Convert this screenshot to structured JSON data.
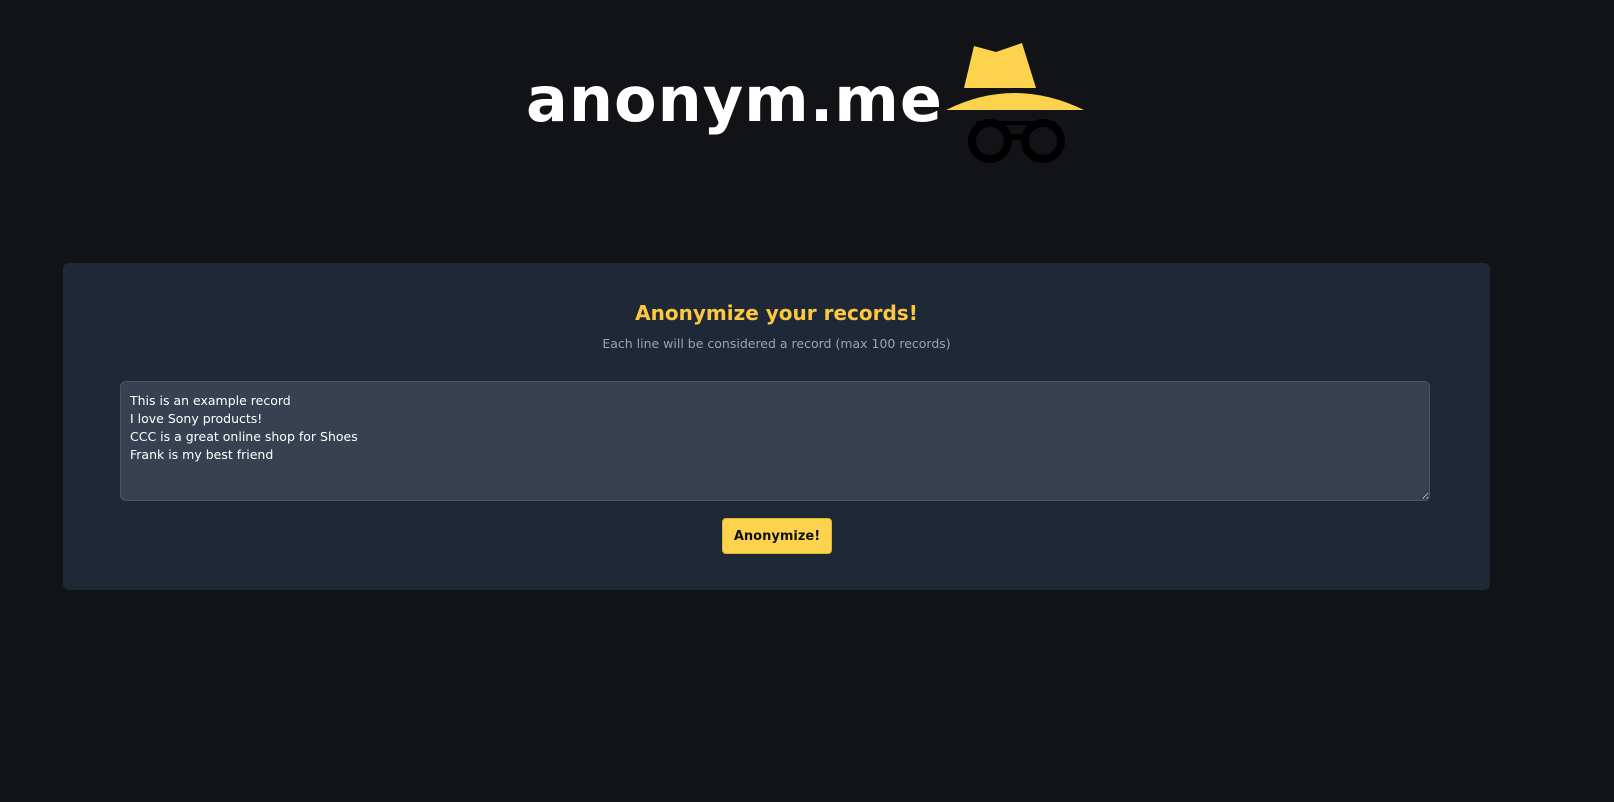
{
  "logo": {
    "text": "anonym.me",
    "icon": "incognito-hat-glasses-icon",
    "accent_color": "#fdd34d"
  },
  "card": {
    "title": "Anonymize your records!",
    "subtitle": "Each line will be considered a record (max 100 records)"
  },
  "records_input": {
    "value": "This is an example record\nI love Sony products!\nCCC is a great online shop for Shoes\nFrank is my best friend"
  },
  "actions": {
    "anonymize_label": "Anonymize!"
  },
  "colors": {
    "background": "#121316",
    "card": "#1f2837",
    "title": "#fbc83f",
    "button": "#fdd34d"
  }
}
